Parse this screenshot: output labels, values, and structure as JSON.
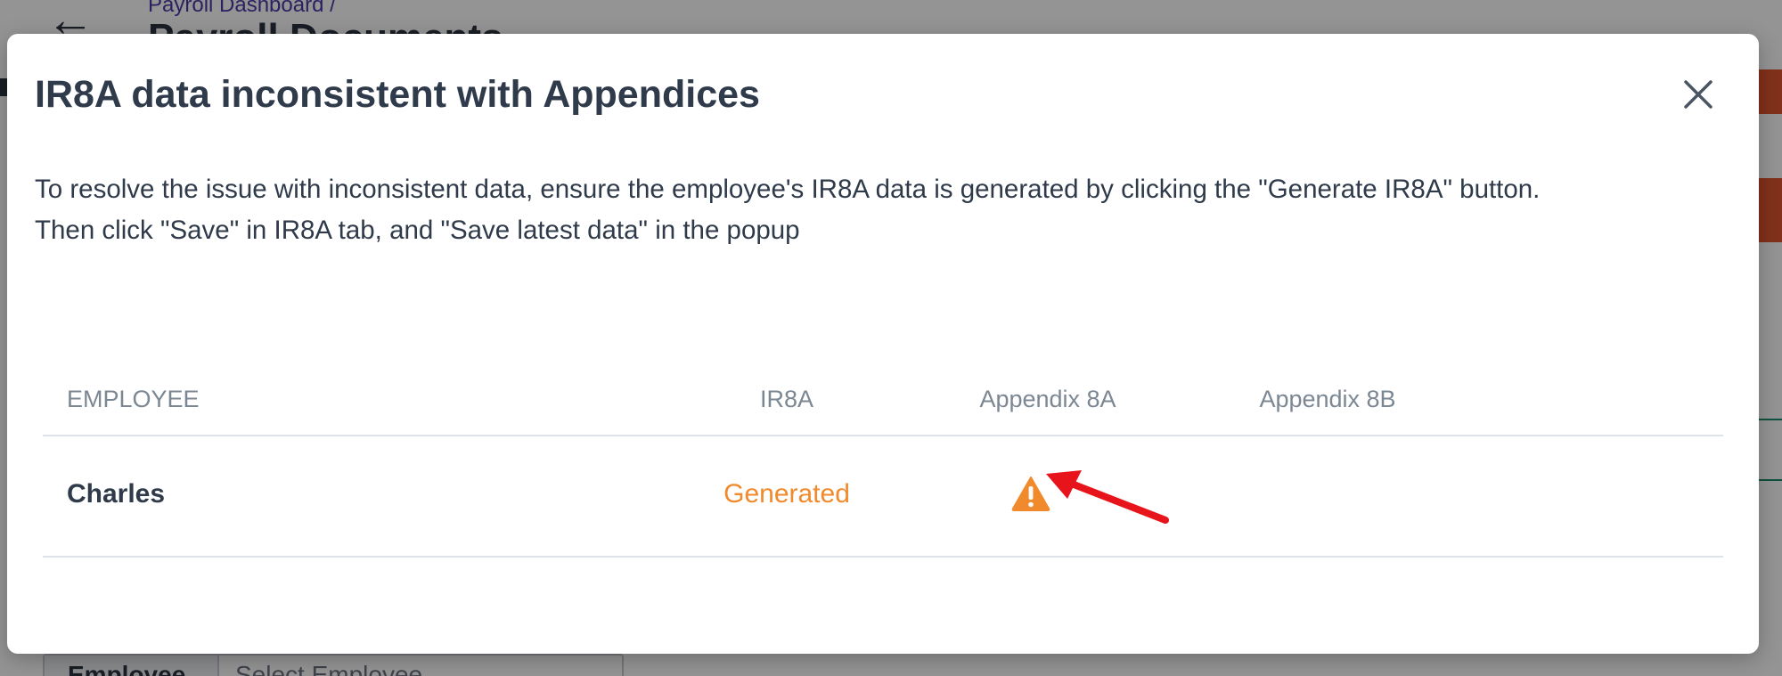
{
  "background": {
    "breadcrumb": "Payroll Dashboard  /",
    "page_title": "Payroll Documents",
    "filter_label": "Employee",
    "filter_placeholder": "Select Employee"
  },
  "modal": {
    "title": "IR8A data inconsistent with Appendices",
    "description_line1": "To resolve the issue with inconsistent data, ensure the employee's IR8A data is generated by clicking the \"Generate IR8A\" button.",
    "description_line2": "Then click \"Save\" in IR8A tab, and \"Save latest data\" in the popup",
    "table": {
      "headers": [
        "EMPLOYEE",
        "IR8A",
        "Appendix 8A",
        "Appendix 8B"
      ],
      "rows": [
        {
          "employee": "Charles",
          "ir8a": "Generated",
          "appendix_8a": "warning-icon",
          "appendix_8b": ""
        }
      ]
    }
  },
  "colors": {
    "accent_orange": "#f08a2c",
    "annotation_red": "#e8141c",
    "title_text": "#2f3a4a",
    "header_text": "#7c8794"
  },
  "icons": {
    "close": "close-icon",
    "status": "warning-icon",
    "back": "back-arrow-icon"
  }
}
